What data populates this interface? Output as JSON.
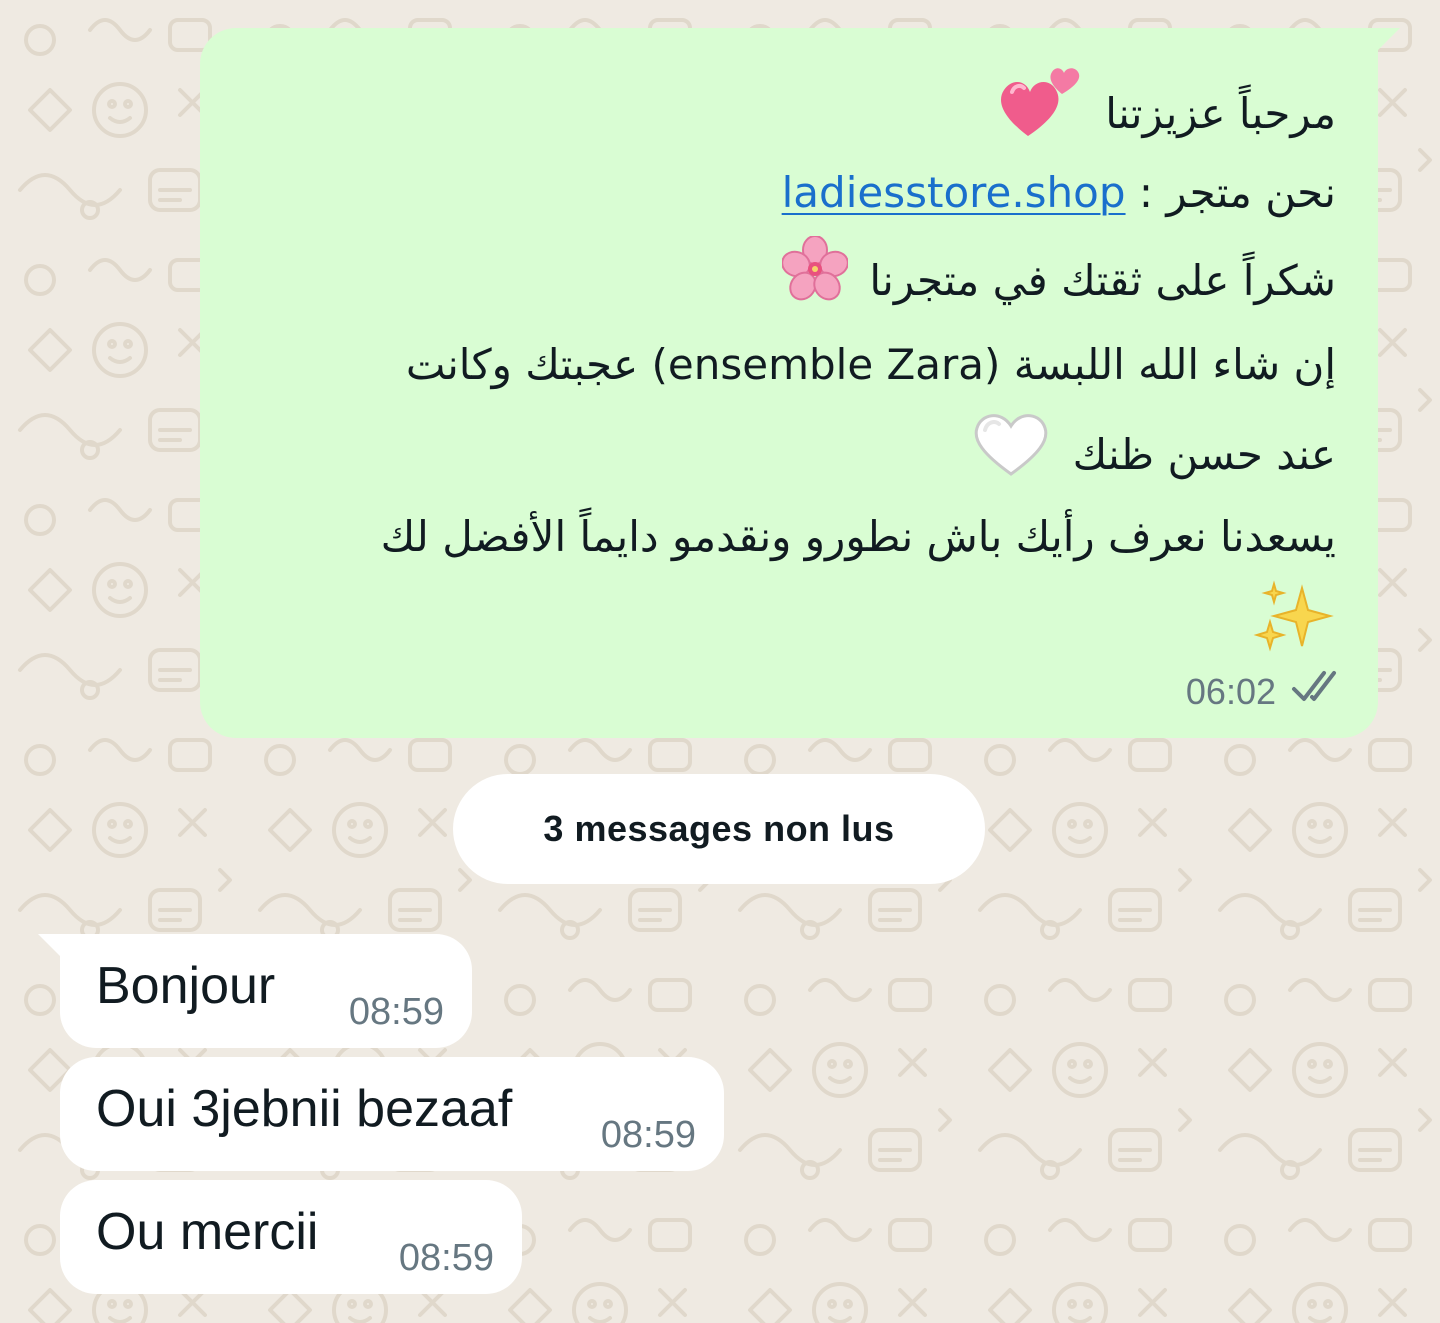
{
  "outgoing_message": {
    "greeting": "مرحباً عزيزتنا",
    "greeting_emoji": "two-hearts-icon",
    "store_intro": "نحن متجر :",
    "store_link": "ladiesstore.shop",
    "thanks": "شكراً على ثقتك في متجرنا",
    "thanks_emoji": "cherry-blossom-icon",
    "line4_ar_start": "إن شاء الله اللبسة",
    "line4_product": "(ensemble Zara)",
    "line4_ar_end": "عجبتك وكانت",
    "line5": "عند حسن ظنك",
    "line5_emoji": "white-heart-icon",
    "line6": "يسعدنا نعرف رأيك باش نطورو ونقدمو دايماً الأفضل لك",
    "line7_emoji": "sparkles-icon",
    "time": "06:02",
    "status": "read"
  },
  "unread_divider": {
    "label": "3 messages non lus"
  },
  "incoming_messages": [
    {
      "text": "Bonjour",
      "time": "08:59"
    },
    {
      "text": "Oui 3jebnii bezaaf",
      "time": "08:59"
    },
    {
      "text": "Ou mercii",
      "time": "08:59"
    }
  ],
  "colors": {
    "wallpaper": "#efeae2",
    "outgoing_bubble": "#d9fdd3",
    "incoming_bubble": "#ffffff",
    "link": "#1a6fcc",
    "meta_text": "#667781",
    "primary_text": "#111b21"
  }
}
